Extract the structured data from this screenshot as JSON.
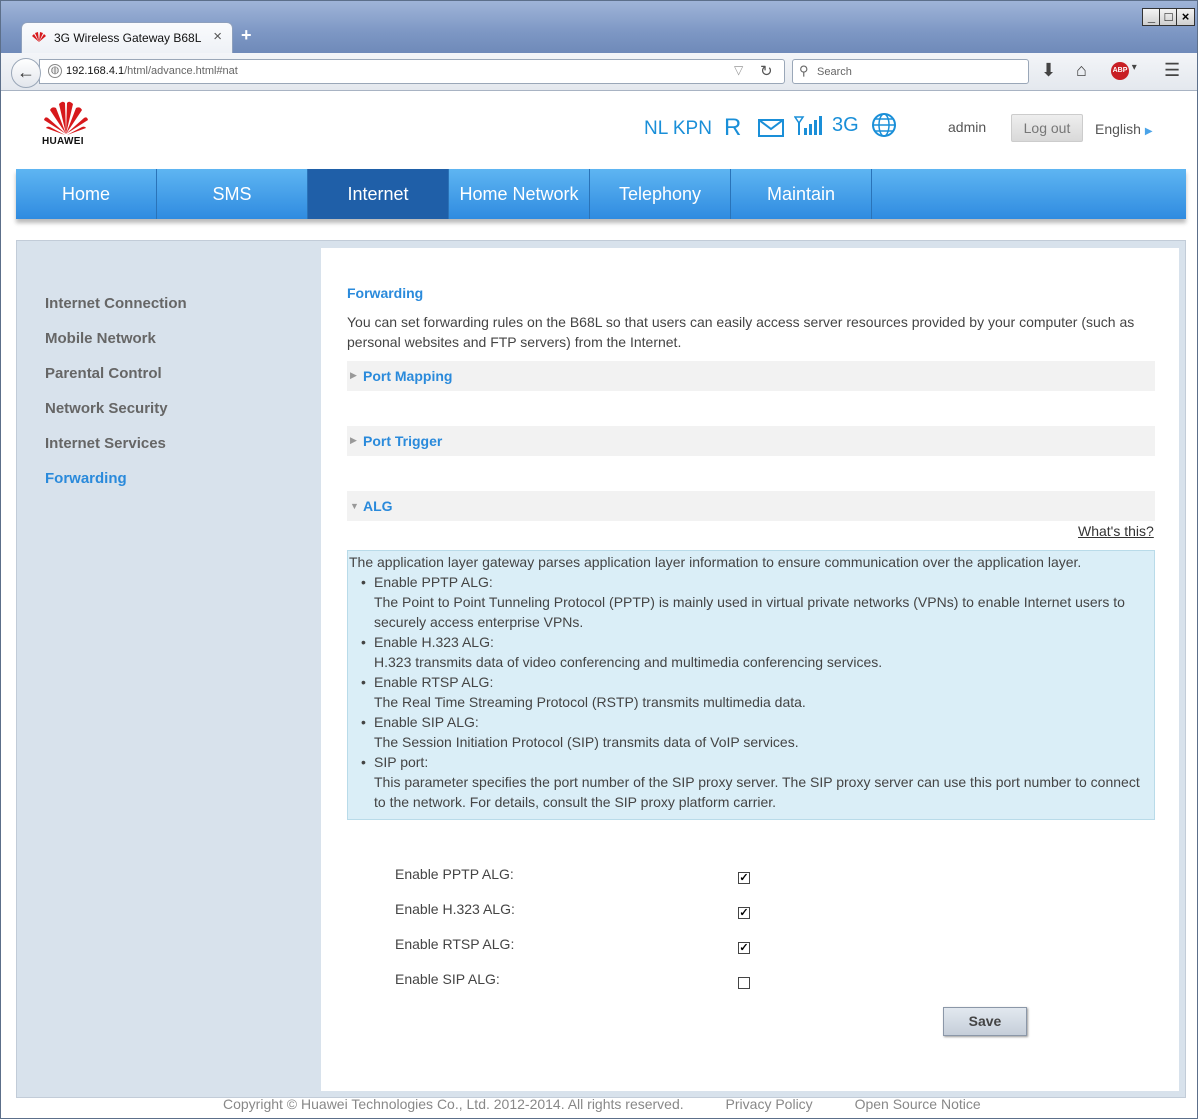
{
  "browser": {
    "tab_title": "3G Wireless Gateway B68L",
    "url_host": "192.168.4.1",
    "url_path": "/html/advance.html#nat",
    "search_placeholder": "Search",
    "window_min": "_",
    "window_max": "□",
    "window_close": "×",
    "new_tab": "+",
    "tab_close": "×",
    "abp_badge": "ABP"
  },
  "header": {
    "brand": "HUAWEI",
    "operator": "NL KPN",
    "roaming": "R",
    "network_type": "3G",
    "user": "admin",
    "logout_label": "Log out",
    "language": "English"
  },
  "menu": {
    "items": [
      "Home",
      "SMS",
      "Internet",
      "Home Network",
      "Telephony",
      "Maintain"
    ],
    "active": "Internet"
  },
  "sidebar": {
    "items": [
      "Internet Connection",
      "Mobile Network",
      "Parental Control",
      "Network Security",
      "Internet Services",
      "Forwarding"
    ],
    "active": "Forwarding"
  },
  "main": {
    "title": "Forwarding",
    "description": "You can set forwarding rules on the B68L so that users can easily access server resources provided by your computer (such as personal websites and FTP servers) from the Internet.",
    "sections": [
      "Port Mapping",
      "Port Trigger",
      "ALG"
    ],
    "whats_this": "What's this?",
    "alg_help": {
      "intro": "The application layer gateway parses application layer information to ensure communication over the application layer.",
      "items": [
        {
          "title": "Enable PPTP ALG:",
          "text": "The Point to Point Tunneling Protocol (PPTP) is mainly used in virtual private networks (VPNs) to enable Internet users to securely access enterprise VPNs."
        },
        {
          "title": "Enable H.323 ALG:",
          "text": "H.323 transmits data of video conferencing and multimedia conferencing services."
        },
        {
          "title": "Enable RTSP ALG:",
          "text": "The Real Time Streaming Protocol (RSTP) transmits multimedia data."
        },
        {
          "title": "Enable SIP ALG:",
          "text": "The Session Initiation Protocol (SIP) transmits data of VoIP services."
        },
        {
          "title": "SIP port:",
          "text": "This parameter specifies the port number of the SIP proxy server. The SIP proxy server can use this port number to connect to the network. For details, consult the SIP proxy platform carrier."
        }
      ]
    },
    "form": {
      "rows": [
        {
          "label": "Enable PPTP ALG:",
          "checked": true
        },
        {
          "label": "Enable H.323 ALG:",
          "checked": true
        },
        {
          "label": "Enable RTSP ALG:",
          "checked": true
        },
        {
          "label": "Enable SIP ALG:",
          "checked": false
        }
      ],
      "save_label": "Save"
    }
  },
  "footer": {
    "copyright": "Copyright © Huawei Technologies Co., Ltd. 2012-2014. All rights reserved.",
    "privacy": "Privacy Policy",
    "open_source": "Open Source Notice"
  },
  "colors": {
    "accent": "#2a8adb",
    "menu_active": "#1f5fa8",
    "help_bg": "#daeef7"
  }
}
